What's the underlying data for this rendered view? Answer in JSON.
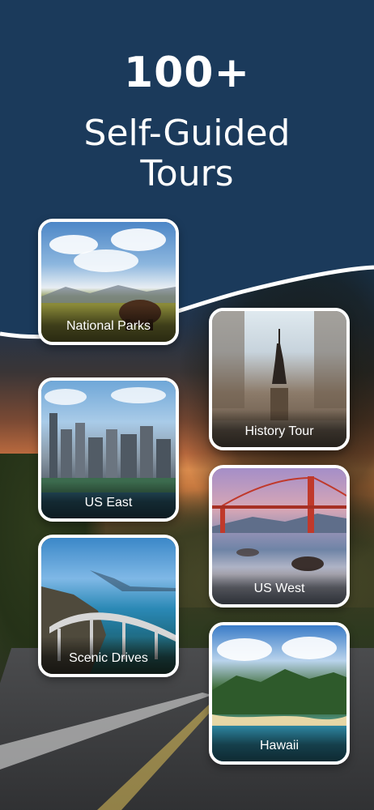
{
  "header": {
    "title": "100+",
    "subtitle_line1": "Self-Guided",
    "subtitle_line2": "Tours",
    "background_color": "#1a3a5c"
  },
  "tours": [
    {
      "label": "National Parks"
    },
    {
      "label": "History Tour"
    },
    {
      "label": "US East"
    },
    {
      "label": "US West"
    },
    {
      "label": "Scenic Drives"
    },
    {
      "label": "Hawaii"
    }
  ]
}
